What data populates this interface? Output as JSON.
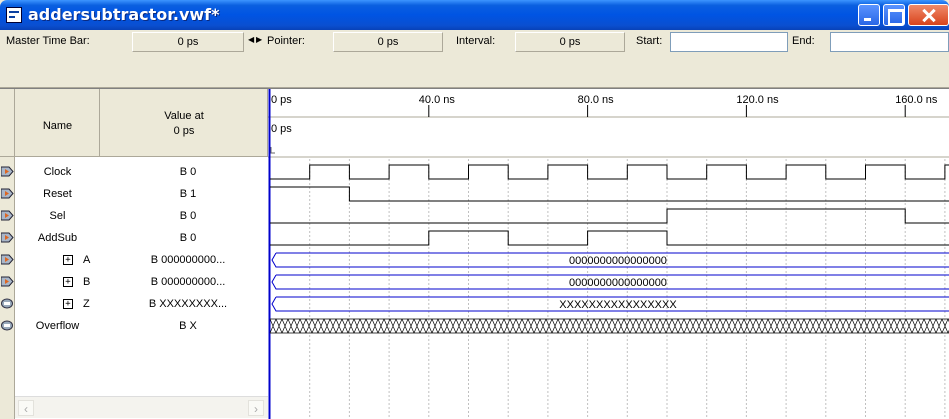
{
  "window": {
    "title": "addersubtractor.vwf*"
  },
  "timebar": {
    "master_time_bar_label": "Master Time Bar:",
    "master_time_bar_value": "0 ps",
    "pointer_label": "Pointer:",
    "pointer_value": "0 ps",
    "interval_label": "Interval:",
    "interval_value": "0 ps",
    "start_label": "Start:",
    "start_value": "",
    "end_label": "End:",
    "end_value": ""
  },
  "columns": {
    "name": "Name",
    "value_at_line1": "Value at",
    "value_at_line2": "0 ps"
  },
  "time_axis": {
    "ticks": [
      "0 ps",
      "40.0 ns",
      "80.0 ns",
      "120.0 ns",
      "160.0 ns"
    ],
    "cursor_label": "0 ps"
  },
  "signals": [
    {
      "name": "Clock",
      "value": "B 0",
      "type": "input",
      "group": false
    },
    {
      "name": "Reset",
      "value": "B 1",
      "type": "input",
      "group": false
    },
    {
      "name": "Sel",
      "value": "B 0",
      "type": "input",
      "group": false
    },
    {
      "name": "AddSub",
      "value": "B 0",
      "type": "input",
      "group": false
    },
    {
      "name": "A",
      "value": "B 000000000...",
      "type": "input-bus",
      "group": true,
      "bus_value": "0000000000000000"
    },
    {
      "name": "B",
      "value": "B 000000000...",
      "type": "input-bus",
      "group": true,
      "bus_value": "0000000000000000"
    },
    {
      "name": "Z",
      "value": "B XXXXXXXX...",
      "type": "output-bus",
      "group": true,
      "bus_value": "XXXXXXXXXXXXXXXX"
    },
    {
      "name": "Overflow",
      "value": "B X",
      "type": "output",
      "group": false
    }
  ],
  "waveforms": {
    "time_unit": "ns",
    "clock_period": 20,
    "clock_first_high": 10,
    "reset_high_until": 20,
    "sel_high_from": 100,
    "sel_high_until": 160,
    "addsub_high_intervals": [
      [
        40,
        60
      ],
      [
        80,
        100
      ]
    ]
  },
  "colors": {
    "title_blue": "#0054e3",
    "wave": "#000000",
    "bus": "#0000cc",
    "grid": "#c0c0c0"
  },
  "icons": {
    "input_pin": "input-pin-icon",
    "output_pin": "output-pin-icon",
    "expand": "expand-plus-icon"
  }
}
